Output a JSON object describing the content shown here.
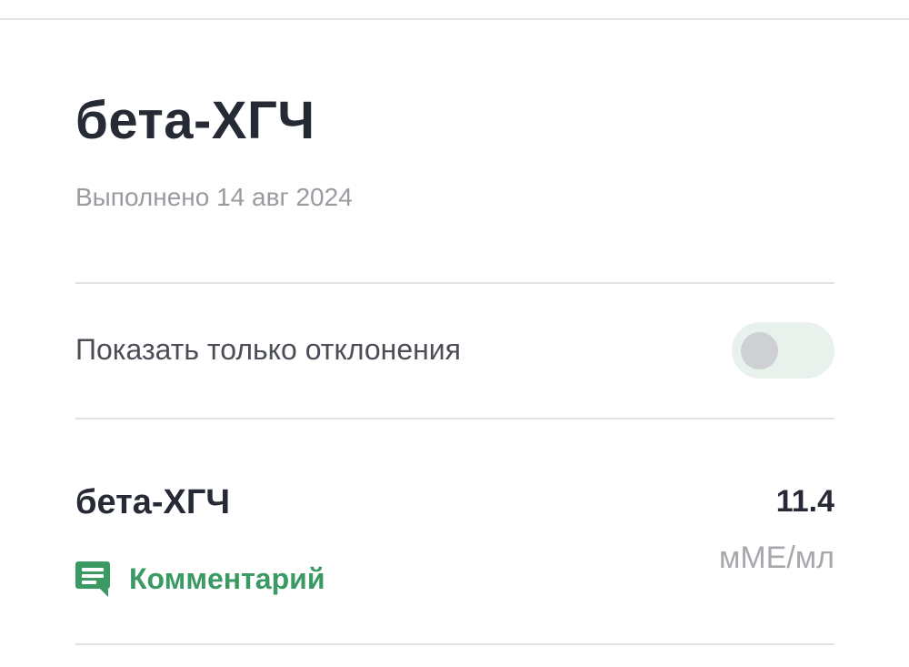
{
  "header": {
    "title": "бета-ХГЧ",
    "completed_text": "Выполнено 14 авг 2024"
  },
  "filter": {
    "label": "Показать только отклонения",
    "enabled": false
  },
  "results": [
    {
      "name": "бета-ХГЧ",
      "value": "11.4",
      "unit": "мМЕ/мл",
      "comment_label": "Комментарий",
      "comment_icon": "comment-icon"
    }
  ],
  "colors": {
    "accent": "#3b9a63",
    "toggle_track": "#e8f1ec",
    "toggle_knob": "#cfd0d4",
    "title_text": "#262a35",
    "muted_text": "#9a9ba1"
  }
}
